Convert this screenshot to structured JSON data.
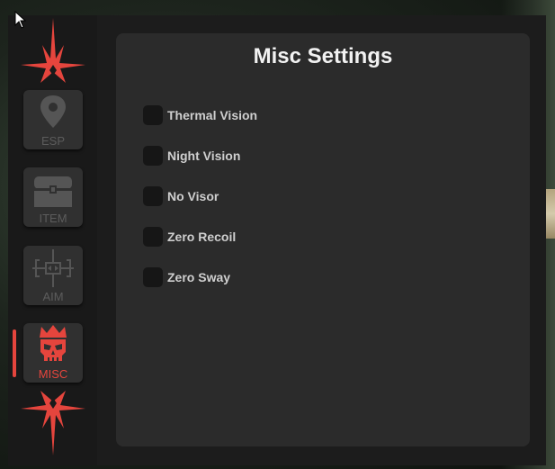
{
  "panel": {
    "title": "Misc Settings",
    "options": [
      {
        "label": "Thermal Vision",
        "checked": false
      },
      {
        "label": "Night Vision",
        "checked": false
      },
      {
        "label": "No Visor",
        "checked": false
      },
      {
        "label": "Zero Recoil",
        "checked": false
      },
      {
        "label": "Zero Sway",
        "checked": false
      }
    ]
  },
  "nav": {
    "items": [
      {
        "label": "ESP",
        "icon": "map-pin-icon",
        "active": false
      },
      {
        "label": "ITEM",
        "icon": "treasure-chest-icon",
        "active": false
      },
      {
        "label": "AIM",
        "icon": "crosshair-icon",
        "active": false
      },
      {
        "label": "MISC",
        "icon": "skull-crown-icon",
        "active": true
      }
    ]
  },
  "colors": {
    "accent": "#e5453d",
    "panel_bg": "#2b2b2b",
    "sidebar_bg": "#191919",
    "inactive_icon": "#5c5c5c"
  }
}
